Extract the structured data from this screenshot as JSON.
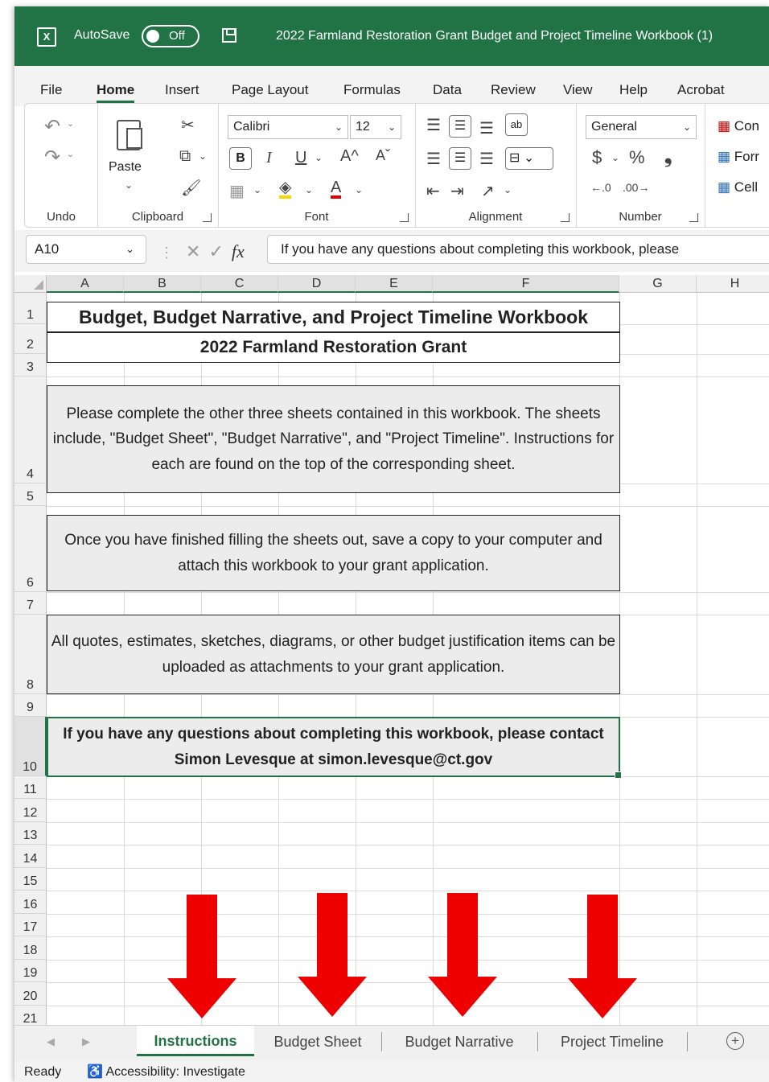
{
  "titlebar": {
    "app_icon": "excel-icon",
    "autosave_label": "AutoSave",
    "autosave_state": "Off",
    "save_icon": "save-icon",
    "document_title": "2022 Farmland Restoration Grant Budget and Project Timeline Workbook (1)"
  },
  "ribbon_tabs": [
    "File",
    "Home",
    "Insert",
    "Page Layout",
    "Formulas",
    "Data",
    "Review",
    "View",
    "Help",
    "Acrobat"
  ],
  "ribbon": {
    "undo_group": "Undo",
    "clipboard_group": "Clipboard",
    "paste_label": "Paste",
    "font_group": "Font",
    "font_name": "Calibri",
    "font_size": "12",
    "bold": "B",
    "italic": "I",
    "underline": "U",
    "grow_font": "A^",
    "shrink_font": "Aˇ",
    "font_color_letter": "A",
    "alignment_group": "Alignment",
    "number_group": "Number",
    "number_format": "General",
    "currency": "$",
    "percent": "%",
    "comma": "❟",
    "styles_items": [
      "Con",
      "Forr",
      "Cell"
    ]
  },
  "formula_bar": {
    "name_box": "A10",
    "fx_label": "fx",
    "content": "If you have any questions about completing this workbook, please"
  },
  "columns": [
    "A",
    "B",
    "C",
    "D",
    "E",
    "F",
    "G",
    "H"
  ],
  "rows": [
    "1",
    "2",
    "3",
    "4",
    "5",
    "6",
    "7",
    "8",
    "9",
    "10",
    "11",
    "12",
    "13",
    "14",
    "15",
    "16",
    "17",
    "18",
    "19",
    "20",
    "21"
  ],
  "cells": {
    "r1": "Budget, Budget Narrative, and Project Timeline Workbook",
    "r2": "2022 Farmland Restoration Grant",
    "r4": "Please complete the other three sheets contained in this workbook. The sheets include, \"Budget Sheet\", \"Budget Narrative\", and \"Project Timeline\". Instructions for each are found on the top of the corresponding sheet.",
    "r6": "Once you have finished filling the sheets out, save a copy to your computer and attach this workbook to your grant application.",
    "r8": "All quotes, estimates, sketches, diagrams, or other budget justification items can be uploaded as attachments to your grant application.",
    "r10": "If you have any questions about completing this workbook, please contact Simon Levesque at simon.levesque@ct.gov"
  },
  "sheet_tabs": [
    "Instructions",
    "Budget Sheet",
    "Budget Narrative",
    "Project Timeline"
  ],
  "active_sheet": "Instructions",
  "status": {
    "ready": "Ready",
    "accessibility": "Accessibility: Investigate"
  },
  "colors": {
    "excel_green": "#217346",
    "arrow_red": "#ee0000"
  }
}
